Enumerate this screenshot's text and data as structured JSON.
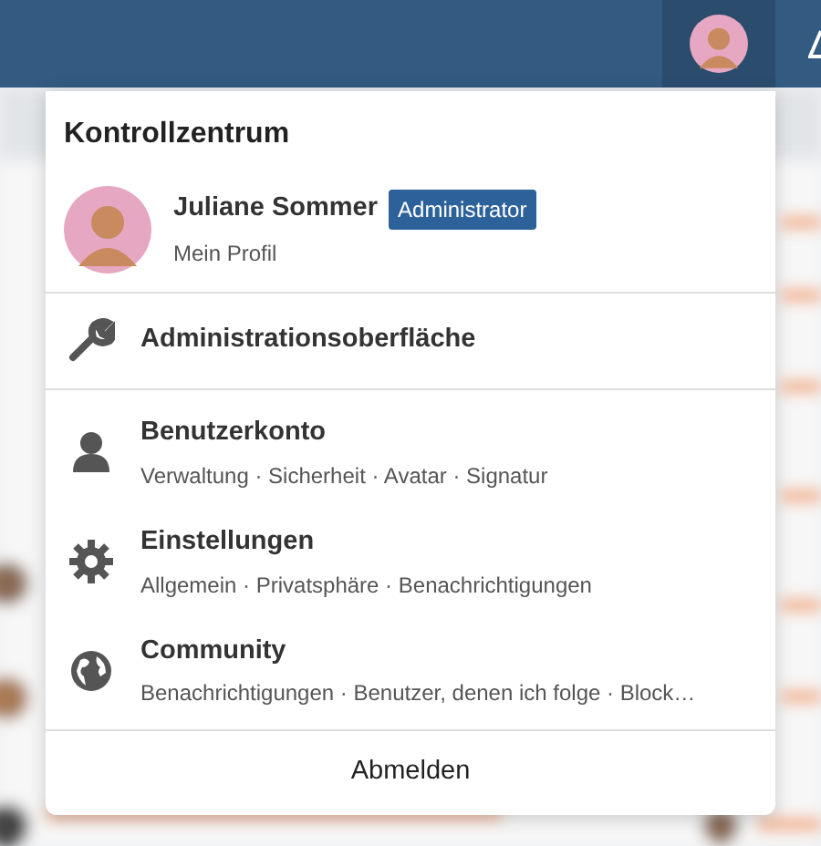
{
  "top_bar": {
    "avatar_button": {
      "selected": true
    }
  },
  "menu": {
    "title": "Kontrollzentrum",
    "profile": {
      "name": "Juliane Sommer",
      "badge": "Administrator",
      "link": "Mein Profil"
    },
    "admin_link": {
      "label": "Administrationsoberfläche"
    },
    "sections": [
      {
        "title": "Benutzerkonto",
        "subtitle": "Verwaltung · Sicherheit · Avatar · Signatur"
      },
      {
        "title": "Einstellungen",
        "subtitle": "Allgemein · Privatsphäre · Benachrichtigungen"
      },
      {
        "title": "Community",
        "subtitle": "Benachrichtigungen · Benutzer, denen ich folge · Block…"
      }
    ],
    "logout": "Abmelden"
  }
}
